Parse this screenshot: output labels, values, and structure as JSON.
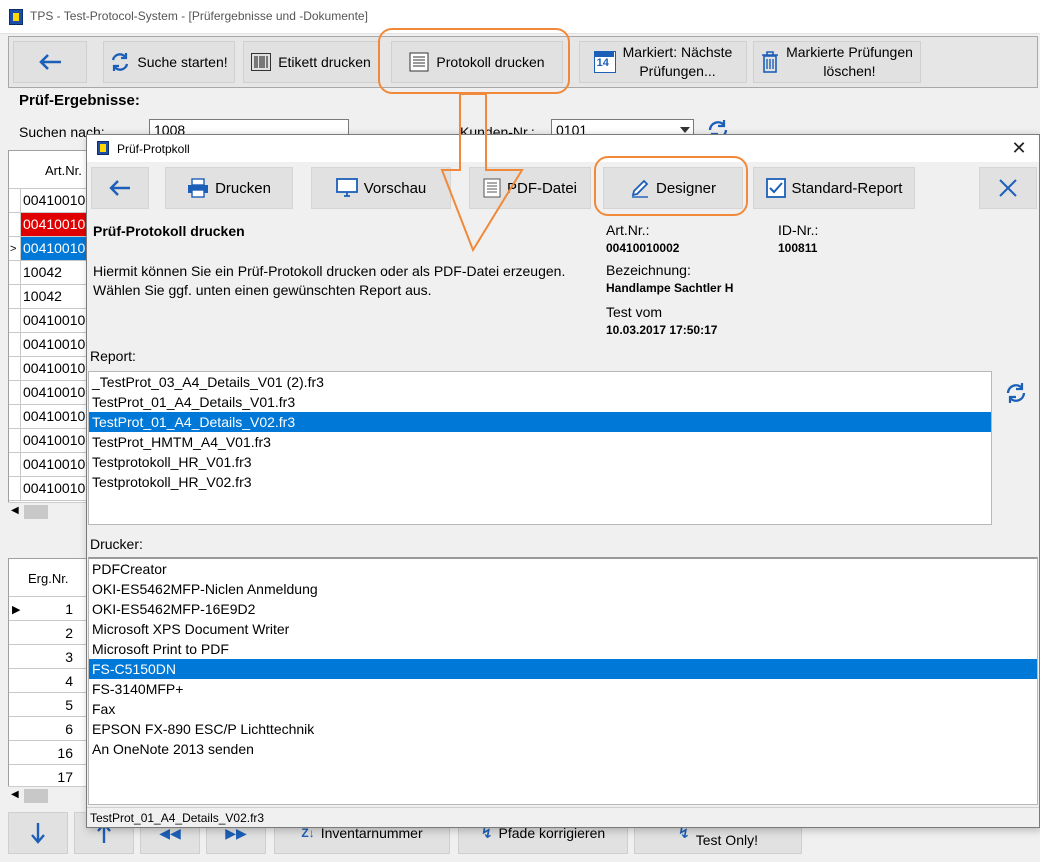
{
  "window": {
    "title": "TPS - Test-Protocol-System - [Prüfergebnisse und -Dokumente]"
  },
  "toolbar": {
    "search_label": "Suche starten!",
    "label_print": "Etikett drucken",
    "protocol_print": "Protokoll drucken",
    "next_tests_line1": "Markiert: Nächste",
    "next_tests_line2": "Prüfungen...",
    "next_tests_badge": "14",
    "delete_line1": "Markierte Prüfungen",
    "delete_line2": "löschen!"
  },
  "results": {
    "title": "Prüf-Ergebnisse:",
    "search_label": "Suchen  nach:",
    "search_value": "1008",
    "customer_label": "Kunden-Nr.:",
    "customer_value": "0101",
    "column_header": "Art.Nr.",
    "rows": [
      "00410010",
      "00410010",
      "00410010",
      "10042",
      "10042",
      "00410010",
      "00410010",
      "00410010",
      "00410010",
      "00410010",
      "00410010",
      "00410010",
      "00410010"
    ],
    "lower_column_header": "Erg.Nr.",
    "lower_rows": [
      "1",
      "2",
      "3",
      "4",
      "5",
      "6",
      "16",
      "17"
    ]
  },
  "bottom": {
    "inventory_label": "Inventarnummer",
    "fix_label": "Pfade korrigieren",
    "test_only_label": "Test Only!"
  },
  "dialog": {
    "title": "Prüf-Protpkoll",
    "buttons": {
      "print": "Drucken",
      "preview": "Vorschau",
      "pdf": "PDF-Datei",
      "designer": "Designer",
      "standard_report": "Standard-Report"
    },
    "heading": "Prüf-Protokoll drucken",
    "description_line1": "Hiermit können Sie ein Prüf-Protokoll drucken oder als PDF-Datei erzeugen.",
    "description_line2": "Wählen Sie ggf. unten einen gewünschten Report aus.",
    "art_label": "Art.Nr.:",
    "art_value": "00410010002",
    "id_label": "ID-Nr.:",
    "id_value": "100811",
    "name_label": "Bezeichnung:",
    "name_value": "Handlampe Sachtler H",
    "test_label": "Test vom",
    "test_value": "10.03.2017 17:50:17",
    "report_label": "Report:",
    "reports": [
      "_TestProt_03_A4_Details_V01 (2).fr3",
      "TestProt_01_A4_Details_V01.fr3",
      "TestProt_01_A4_Details_V02.fr3",
      "TestProt_HMTM_A4_V01.fr3",
      "Testprotokoll_HR_V01.fr3",
      "Testprotokoll_HR_V02.fr3"
    ],
    "printer_label": "Drucker:",
    "printers": [
      "PDFCreator",
      "OKI-ES5462MFP-Niclen Anmeldung",
      "OKI-ES5462MFP-16E9D2",
      "Microsoft XPS Document Writer",
      "Microsoft Print to PDF",
      "FS-C5150DN",
      "FS-3140MFP+",
      "Fax",
      "EPSON FX-890 ESC/P Lichttechnik",
      "An OneNote 2013 senden"
    ],
    "status_text": "TestProt_01_A4_Details_V02.fr3"
  },
  "colors": {
    "selection": "#0078d7",
    "error_row": "#e00000",
    "annotation": "#f08a3a"
  }
}
